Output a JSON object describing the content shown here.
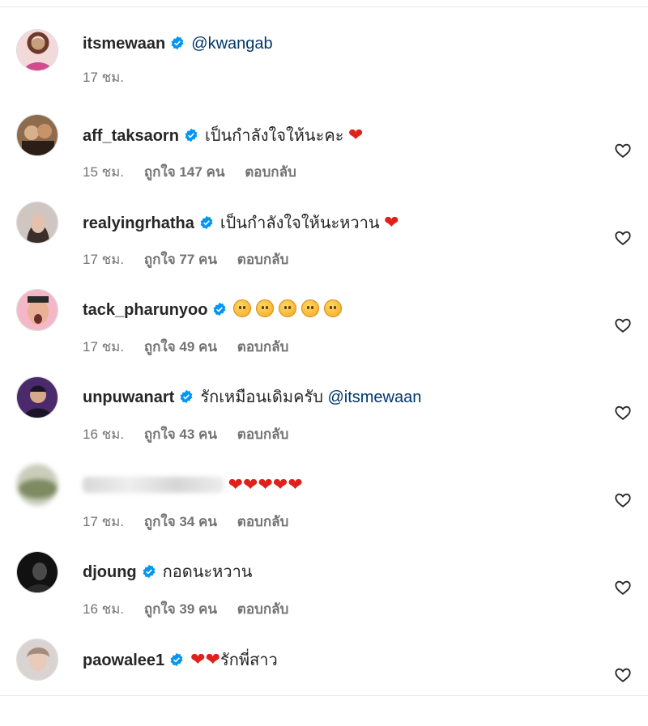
{
  "comments": [
    {
      "username": "itsmewaan",
      "verified": true,
      "text": "",
      "mention": "@kwangab",
      "time": "17 ชม.",
      "likes": "",
      "reply": "",
      "avatar": {
        "bg": "#f3d9d9",
        "fg": "#d34b8f"
      }
    },
    {
      "username": "aff_taksaorn",
      "verified": true,
      "text": "เป็นกำลังใจให้นะคะ",
      "emoji": "❤️",
      "time": "15 ชม.",
      "likes": "ถูกใจ 147 คน",
      "reply": "ตอบกลับ",
      "avatar": {
        "bg": "#8f6b4d",
        "fg": "#2b1e16"
      }
    },
    {
      "username": "realyingrhatha",
      "verified": true,
      "text": "เป็นกำลังใจให้นะหวาน",
      "emoji": "❤️",
      "time": "17 ชม.",
      "likes": "ถูกใจ 77 คน",
      "reply": "ตอบกลับ",
      "avatar": {
        "bg": "#cfc6c2",
        "fg": "#3c2e2b"
      }
    },
    {
      "username": "tack_pharunyoo",
      "verified": true,
      "text": "",
      "emoji_count": 5,
      "time": "17 ชม.",
      "likes": "ถูกใจ 49 คน",
      "reply": "ตอบกลับ",
      "avatar": {
        "bg": "#f4b7c8",
        "fg": "#6d2b2b"
      }
    },
    {
      "username": "unpuwanart",
      "verified": true,
      "text": "รักเหมือนเดิมครับ",
      "mention": "@itsmewaan",
      "time": "16 ชม.",
      "likes": "ถูกใจ 43 คน",
      "reply": "ตอบกลับ",
      "avatar": {
        "bg": "#4b2a6c",
        "fg": "#1b1426"
      }
    },
    {
      "username": "",
      "verified": false,
      "text": "",
      "hearts": 5,
      "time": "17 ชม.",
      "likes": "ถูกใจ 34 คน",
      "reply": "ตอบกลับ",
      "avatar": {
        "bg": "#7d8a62",
        "fg": "#c9cdb9"
      }
    },
    {
      "username": "djoung",
      "verified": true,
      "text": "กอดนะหวาน",
      "time": "16 ชม.",
      "likes": "ถูกใจ 39 คน",
      "reply": "ตอบกลับ",
      "avatar": {
        "bg": "#111111",
        "fg": "#3a3a3a"
      }
    },
    {
      "username": "paowalee1",
      "verified": true,
      "text": "รักพี่สาว",
      "hearts": 2,
      "time": "",
      "likes": "",
      "reply": "",
      "avatar": {
        "bg": "#d9d4d2",
        "fg": "#a58b7e"
      }
    }
  ],
  "colors": {
    "text": "#262626",
    "muted": "#737373",
    "mention": "#00376b",
    "verified": "#0095f6",
    "heart": "#e0201b"
  },
  "icons": {
    "verified": "verified-badge-icon",
    "like": "heart-outline-icon"
  }
}
